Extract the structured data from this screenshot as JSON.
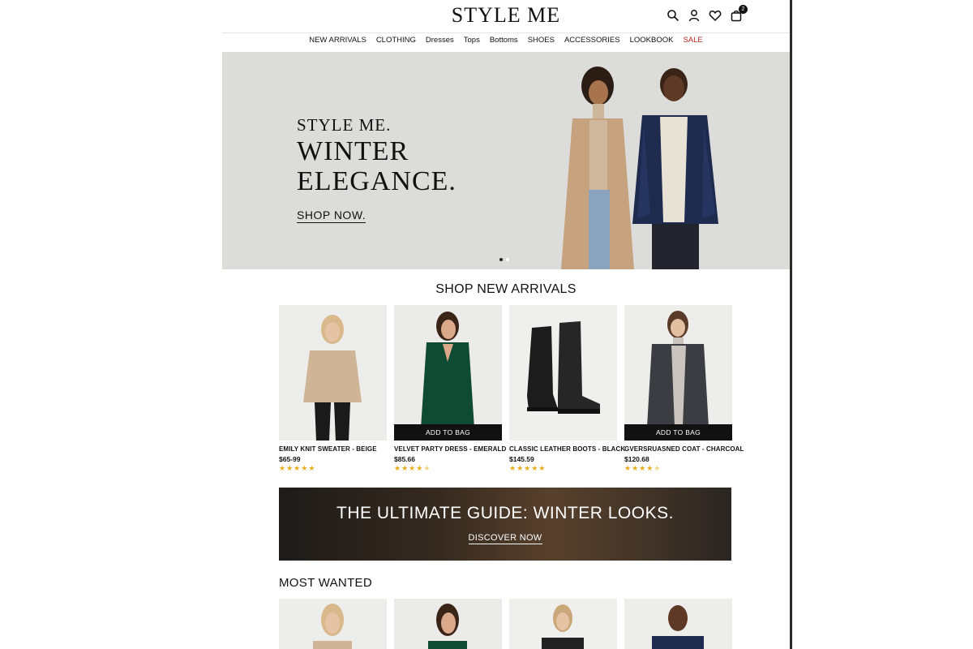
{
  "brand": {
    "logo": "STYLE ME"
  },
  "header": {
    "icons": [
      "search-icon",
      "account-icon",
      "wishlist-icon",
      "bag-icon"
    ],
    "bag_count": "2"
  },
  "nav": {
    "items": [
      {
        "label": "NEW ARRIVALS"
      },
      {
        "label": "CLOTHING"
      },
      {
        "label": "Dresses"
      },
      {
        "label": "Tops"
      },
      {
        "label": "Bottoms"
      },
      {
        "label": "SHOES"
      },
      {
        "label": "ACCESSORIES"
      },
      {
        "label": "LOOKBOOK"
      },
      {
        "label": "SALE"
      }
    ],
    "sale_color": "#b3261e"
  },
  "hero": {
    "subtitle": "STYLE ME.",
    "title_line1": "WINTER",
    "title_line2": "ELEGANCE.",
    "cta": "SHOP NOW."
  },
  "new_arrivals": {
    "title": "SHOP NEW ARRIVALS",
    "products": [
      {
        "name": "EMILY KNIT SWEATER - BEIGE",
        "price": "$65-99",
        "rating": 5,
        "add_label": ""
      },
      {
        "name": "VELVET PARTY DRESS - EMERALD",
        "price": "$85.66",
        "rating": 4.5,
        "add_label": "ADD TO BAG"
      },
      {
        "name": "CLASSIC LEATHER BOOTS - BLACK",
        "price": "$145.59",
        "rating": 5,
        "add_label": ""
      },
      {
        "name": "GVERSRUASNED COAT - CHARCOAL",
        "price": "$120.68",
        "rating": 4.5,
        "add_label": "ADD TO BAG"
      }
    ]
  },
  "guide": {
    "title": "THE ULTIMATE GUIDE: WINTER LOOKS.",
    "cta": "DISCOVER NOW"
  },
  "most_wanted": {
    "title": "MOST WANTED"
  },
  "colors": {
    "accent": "#111111",
    "star": "#e6ad1c",
    "hero_bg": "#dcdcda"
  }
}
